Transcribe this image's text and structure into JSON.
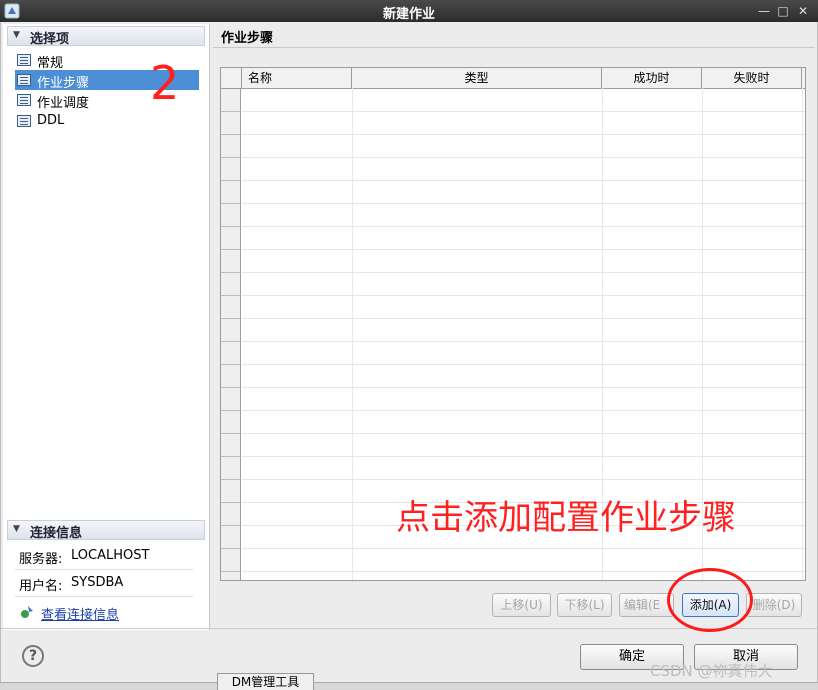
{
  "window": {
    "title": "新建作业",
    "controls": [
      "—",
      "□",
      "✕"
    ]
  },
  "left": {
    "options_header": "选择项",
    "items": [
      {
        "label": "常规"
      },
      {
        "label": "作业步骤",
        "selected": true
      },
      {
        "label": "作业调度"
      },
      {
        "label": "DDL"
      }
    ],
    "connection": {
      "header": "连接信息",
      "server_label": "服务器:",
      "server_value": "LOCALHOST",
      "user_label": "用户名:",
      "user_value": "SYSDBA",
      "view_link": "查看连接信息"
    }
  },
  "main": {
    "title": "作业步骤",
    "table": {
      "columns": [
        "名称",
        "类型",
        "成功时",
        "失败时"
      ],
      "rows": []
    },
    "buttons": {
      "up": "上移(U)",
      "down": "下移(L)",
      "edit": "编辑(E",
      "add": "添加(A)",
      "delete": "删除(D)"
    }
  },
  "footer": {
    "help": "?",
    "ok": "确定",
    "cancel": "取消"
  },
  "annotations": {
    "step_number": "2",
    "instruction": "点击添加配置作业步骤"
  },
  "taskbar": {
    "tab": "DM管理工具"
  },
  "watermark": "CSDN @祢真伟大",
  "colors": {
    "selection": "#4d8fd6",
    "annotation": "#ff2020",
    "link": "#1a3fa8"
  }
}
